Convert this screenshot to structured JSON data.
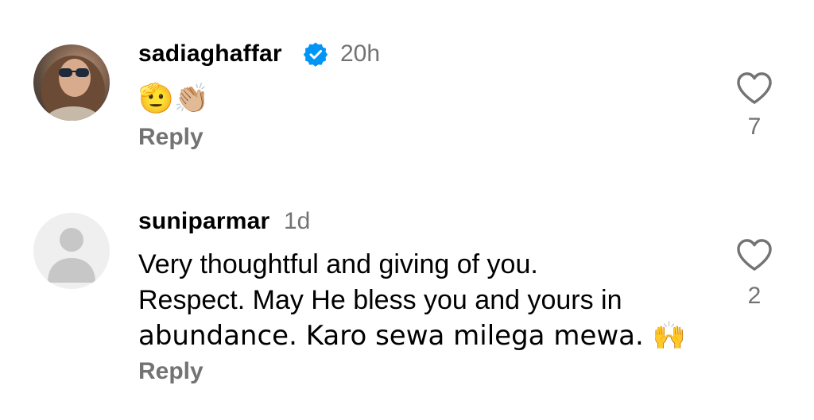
{
  "comments": [
    {
      "username": "sadiaghaffar",
      "verified": true,
      "time": "20h",
      "text": "🫡👏🏼",
      "reply_label": "Reply",
      "likes": "7"
    },
    {
      "username": "suniparmar",
      "verified": false,
      "time": "1d",
      "text_lines": [
        "Very thoughtful and giving of you.",
        "Respect. May He bless you and yours in",
        "abundance. Karo sewa milega mewa. 🙌"
      ],
      "reply_label": "Reply",
      "likes": "2"
    }
  ],
  "colors": {
    "verified_badge": "#0095f6",
    "secondary_text": "#737373"
  },
  "icons": {
    "like": "heart-outline-icon",
    "verified": "verified-badge-icon",
    "default_avatar": "person-silhouette-icon"
  }
}
